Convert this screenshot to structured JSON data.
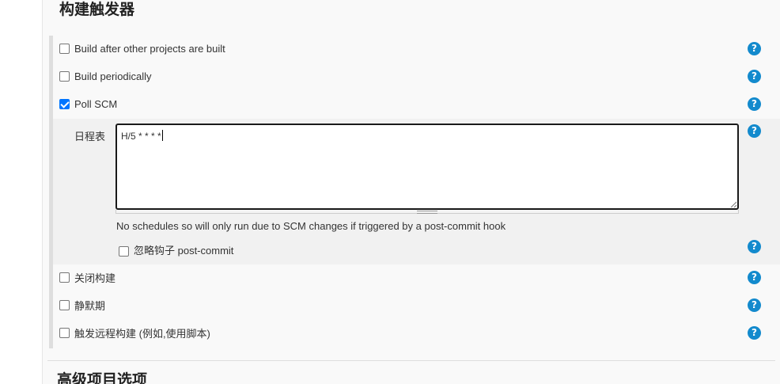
{
  "section": {
    "title": "构建触发器"
  },
  "triggers": [
    {
      "label": "Build after other projects are built",
      "checked": false
    },
    {
      "label": "Build periodically",
      "checked": false
    },
    {
      "label": "Poll SCM",
      "checked": true
    }
  ],
  "poll_scm": {
    "schedule_label": "日程表",
    "schedule_value": "H/5 * * * *",
    "hint": "No schedules so will only run due to SCM changes if triggered by a post-commit hook",
    "ignore_hook_label": "忽略钩子 post-commit",
    "ignore_hook_checked": false
  },
  "more_triggers": [
    {
      "label": "关闭构建",
      "checked": false
    },
    {
      "label": "静默期",
      "checked": false
    },
    {
      "label": "触发远程构建 (例如,使用脚本)",
      "checked": false
    }
  ],
  "help_glyph": "?",
  "next_section": {
    "title": "高级项目选项"
  },
  "colors": {
    "help": "#138acd",
    "checkbox_checked": "#0075ff"
  }
}
